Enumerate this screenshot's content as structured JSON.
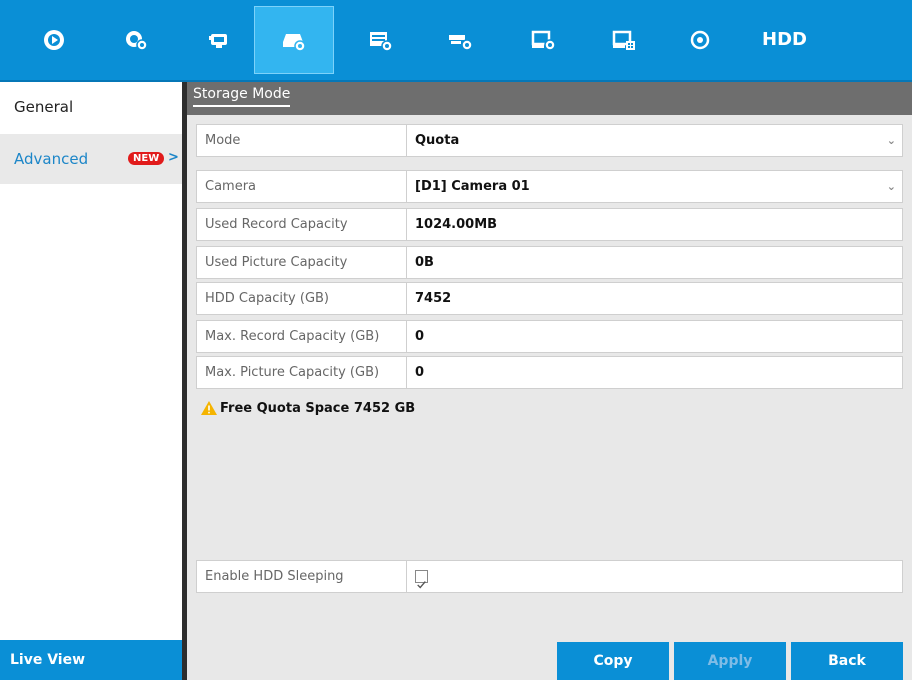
{
  "toolbar": {
    "icons": [
      "play-circle-icon",
      "camera-settings-icon",
      "record-icon",
      "hdd-storage-icon",
      "event-icon",
      "ptz-camera-icon",
      "system-monitor-icon",
      "network-monitor-icon",
      "maintenance-icon"
    ],
    "active_index": 3,
    "title": "HDD"
  },
  "sidebar": {
    "items": [
      {
        "label": "General"
      },
      {
        "label": "Advanced",
        "badge": "NEW",
        "chevron": ">"
      }
    ],
    "live_view_label": "Live View"
  },
  "main": {
    "section_title": "Storage Mode",
    "mode": {
      "label": "Mode",
      "value": "Quota"
    },
    "camera": {
      "label": "Camera",
      "value": "[D1] Camera 01"
    },
    "used_record": {
      "label": "Used Record Capacity",
      "value": "1024.00MB"
    },
    "used_picture": {
      "label": "Used Picture Capacity",
      "value": "0B"
    },
    "hdd_capacity": {
      "label": "HDD Capacity (GB)",
      "value": "7452"
    },
    "max_record": {
      "label": "Max. Record Capacity (GB)",
      "value": "0"
    },
    "max_picture": {
      "label": "Max. Picture Capacity (GB)",
      "value": "0"
    },
    "free_quota_text": "Free Quota Space 7452 GB",
    "hdd_sleeping": {
      "label": "Enable HDD Sleeping",
      "checked": true
    }
  },
  "buttons": {
    "copy": "Copy",
    "apply": "Apply",
    "back": "Back"
  },
  "colors": {
    "accent": "#0a8fd6",
    "active_tab": "#33b5f0",
    "header_bar": "#6e6e6e",
    "badge": "#e11b1b"
  }
}
